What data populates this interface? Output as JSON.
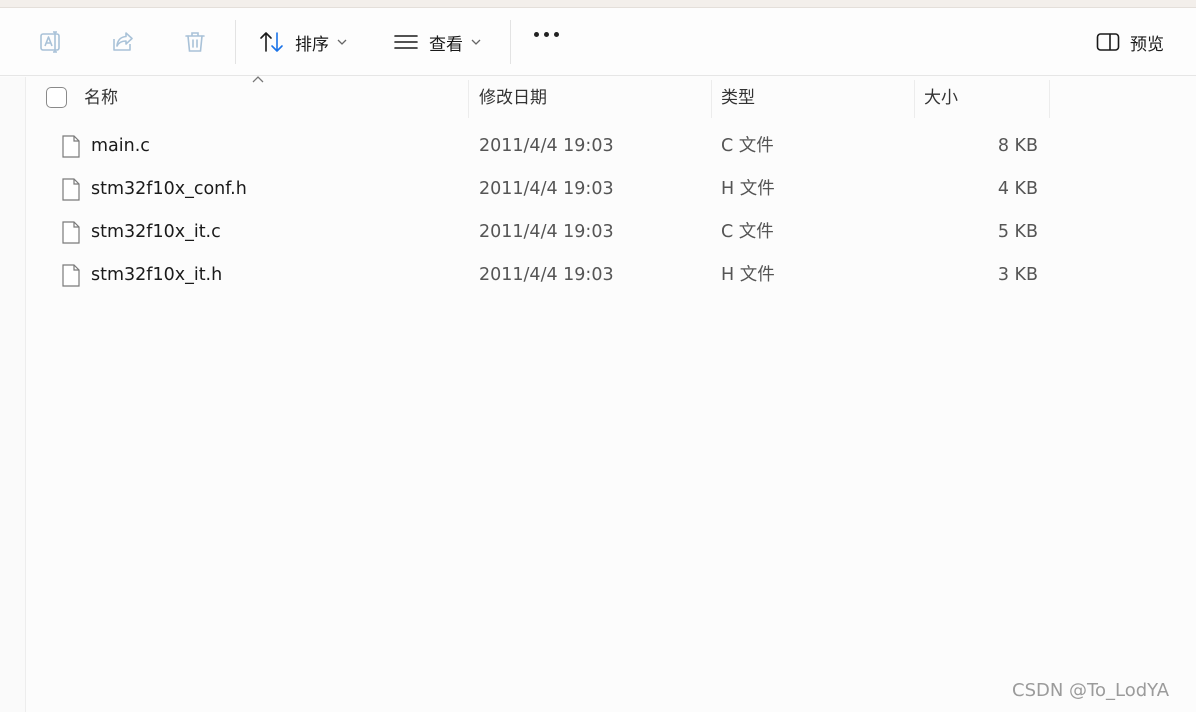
{
  "toolbar": {
    "sort_label": "排序",
    "view_label": "查看",
    "preview_label": "预览"
  },
  "columns": {
    "name": "名称",
    "date": "修改日期",
    "type": "类型",
    "size": "大小"
  },
  "files": [
    {
      "name": "main.c",
      "date": "2011/4/4 19:03",
      "type": "C 文件",
      "size": "8 KB"
    },
    {
      "name": "stm32f10x_conf.h",
      "date": "2011/4/4 19:03",
      "type": "H 文件",
      "size": "4 KB"
    },
    {
      "name": "stm32f10x_it.c",
      "date": "2011/4/4 19:03",
      "type": "C 文件",
      "size": "5 KB"
    },
    {
      "name": "stm32f10x_it.h",
      "date": "2011/4/4 19:03",
      "type": "H 文件",
      "size": "3 KB"
    }
  ],
  "watermark": "CSDN @To_LodYA",
  "colors": {
    "accent": "#1a73e8",
    "disabled_icon": "#a9c2d8"
  }
}
